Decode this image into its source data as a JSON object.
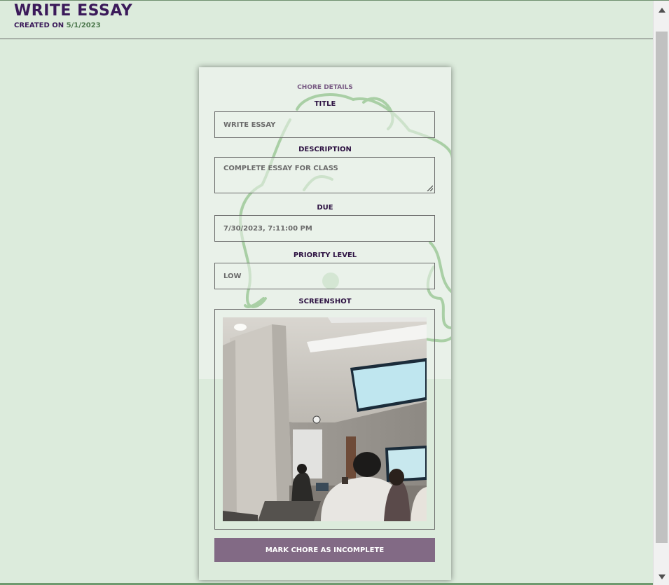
{
  "header": {
    "title": "Write Essay",
    "created_label": "Created on",
    "created_date": "5/1/2023"
  },
  "card": {
    "heading": "Chore Details",
    "title_label": "Title",
    "title_value": "Write Essay",
    "description_label": "Description",
    "description_value": "Complete essay for class",
    "due_label": "Due",
    "due_value": "7/30/2023, 7:11:00 PM",
    "priority_label": "Priority Level",
    "priority_value": "Low",
    "screenshot_label": "Screenshot",
    "mark_button_label": "Mark Chore as Incomplete"
  },
  "scrollbar": {
    "up_icon": "chevron-up-icon",
    "down_icon": "chevron-down-icon"
  },
  "colors": {
    "background": "#dcebdc",
    "title_purple": "#3b1a5a",
    "button": "#826a85",
    "accent_green": "#4f7a4f"
  }
}
